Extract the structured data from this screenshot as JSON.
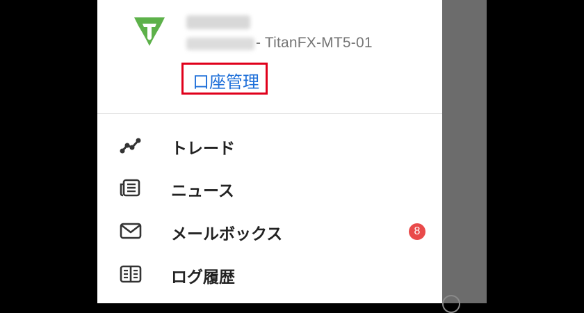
{
  "header": {
    "server_suffix": "- TitanFX-MT5-01",
    "account_manage_label": "口座管理"
  },
  "menu": {
    "items": [
      {
        "label": "トレード",
        "icon": "trade-chart-icon"
      },
      {
        "label": "ニュース",
        "icon": "news-icon"
      },
      {
        "label": "メールボックス",
        "icon": "mail-icon",
        "badge": "8"
      },
      {
        "label": "ログ履歴",
        "icon": "log-book-icon"
      }
    ]
  },
  "colors": {
    "logo_green": "#5db14a",
    "link_blue": "#1e6fd9",
    "highlight_red": "#e0001b",
    "badge_red": "#e94a4a"
  }
}
